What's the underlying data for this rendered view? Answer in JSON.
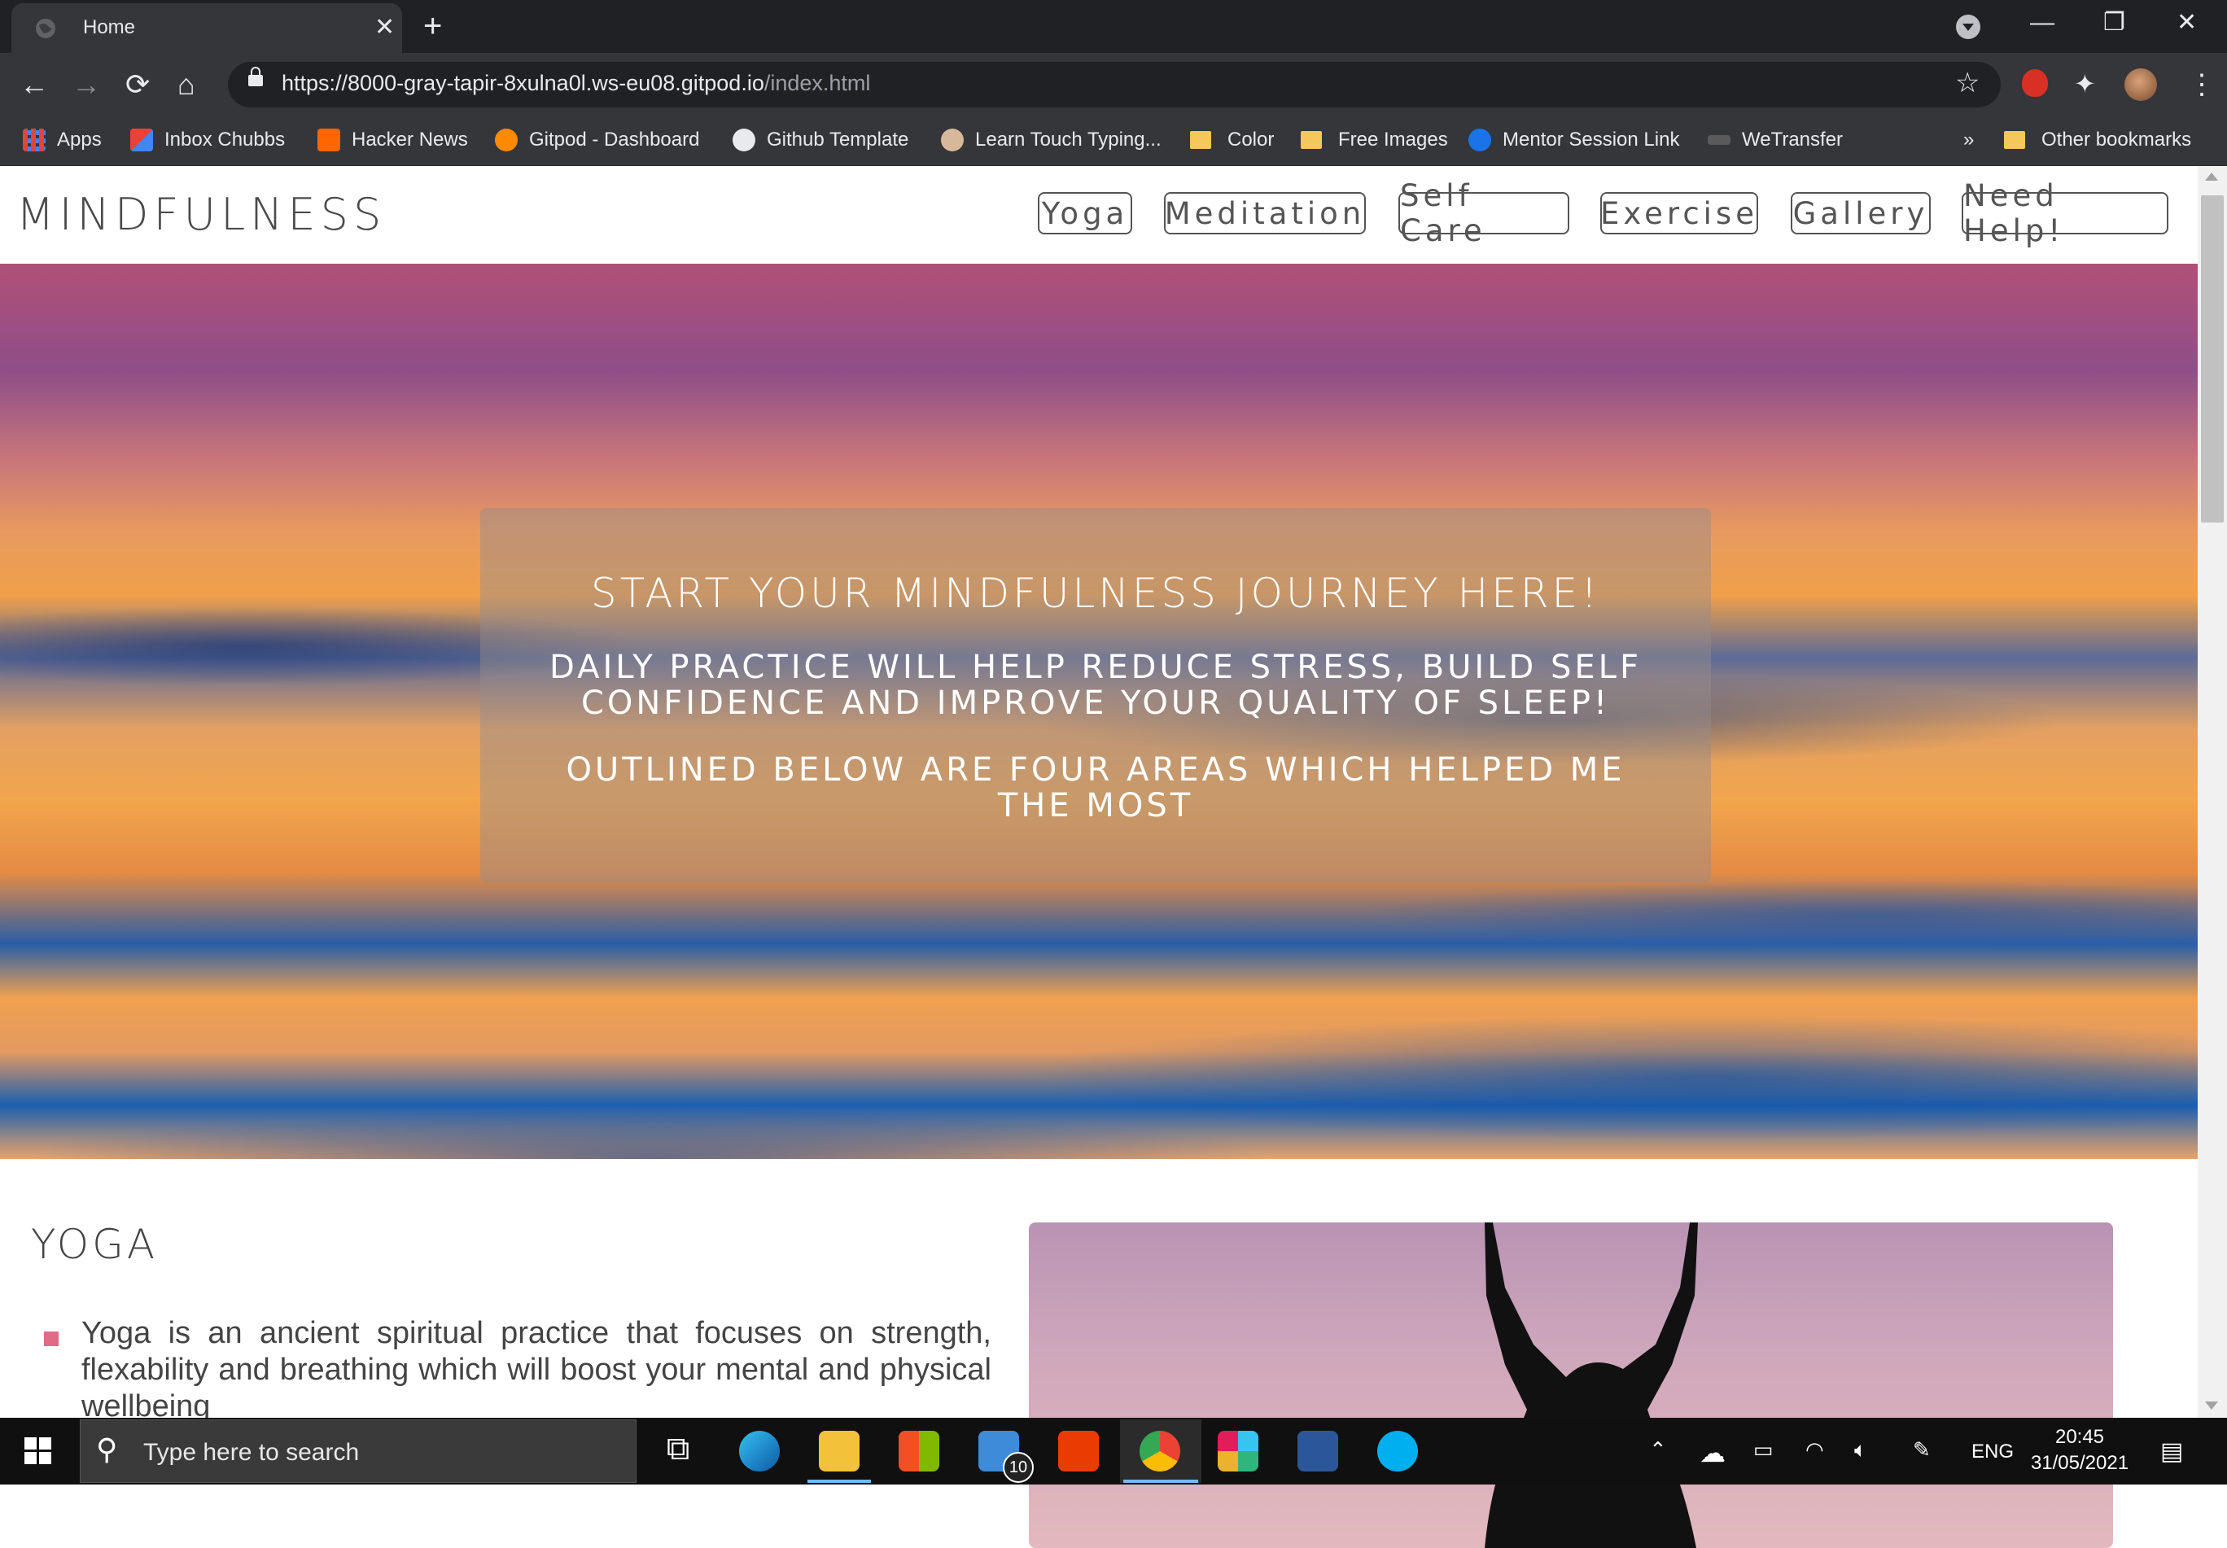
{
  "browser": {
    "tab_title": "Home",
    "tab_close": "✕",
    "new_tab": "+",
    "url_host": "https://8000-gray-tapir-8xulna0l.ws-eu08.gitpod.io",
    "url_path": "/index.html",
    "bookmarks": [
      {
        "label": "Apps",
        "icon": "apps-grid-icon"
      },
      {
        "label": "Inbox Chubbs",
        "icon": "gmail-icon"
      },
      {
        "label": "Hacker News",
        "icon": "ycombinator-icon"
      },
      {
        "label": "Gitpod - Dashboard",
        "icon": "gitpod-icon"
      },
      {
        "label": "Github Template",
        "icon": "github-icon"
      },
      {
        "label": "Learn Touch Typing...",
        "icon": "typing-icon"
      },
      {
        "label": "Color",
        "icon": "folder-icon"
      },
      {
        "label": "Free Images",
        "icon": "folder-icon"
      },
      {
        "label": "Mentor Session Link",
        "icon": "calendly-icon"
      },
      {
        "label": "WeTransfer",
        "icon": "wetransfer-icon"
      }
    ],
    "overflow": "»",
    "other_bookmarks": "Other bookmarks"
  },
  "site": {
    "brand": "MINDFULNESS",
    "nav": [
      "Yoga",
      "Meditation",
      "Self Care",
      "Exercise",
      "Gallery",
      "Need Help!"
    ],
    "hero": {
      "heading": "START YOUR MINDFULNESS JOURNEY HERE!",
      "para1_line1": "DAILY PRACTICE WILL HELP REDUCE STRESS, BUILD SELF",
      "para1_line2": "CONFIDENCE AND IMPROVE YOUR QUALITY OF SLEEP!",
      "para2_line1": "OUTLINED BELOW ARE FOUR AREAS WHICH HELPED ME",
      "para2_line2": "THE MOST"
    },
    "yoga": {
      "title": "YOGA",
      "text": "Yoga is an ancient spiritual practice that focuses on strength, flexability and breathing which will boost your mental and physical wellbeing"
    }
  },
  "taskbar": {
    "search_placeholder": "Type here to search",
    "mail_badge": "10",
    "language": "ENG",
    "time": "20:45",
    "date": "31/05/2021"
  }
}
